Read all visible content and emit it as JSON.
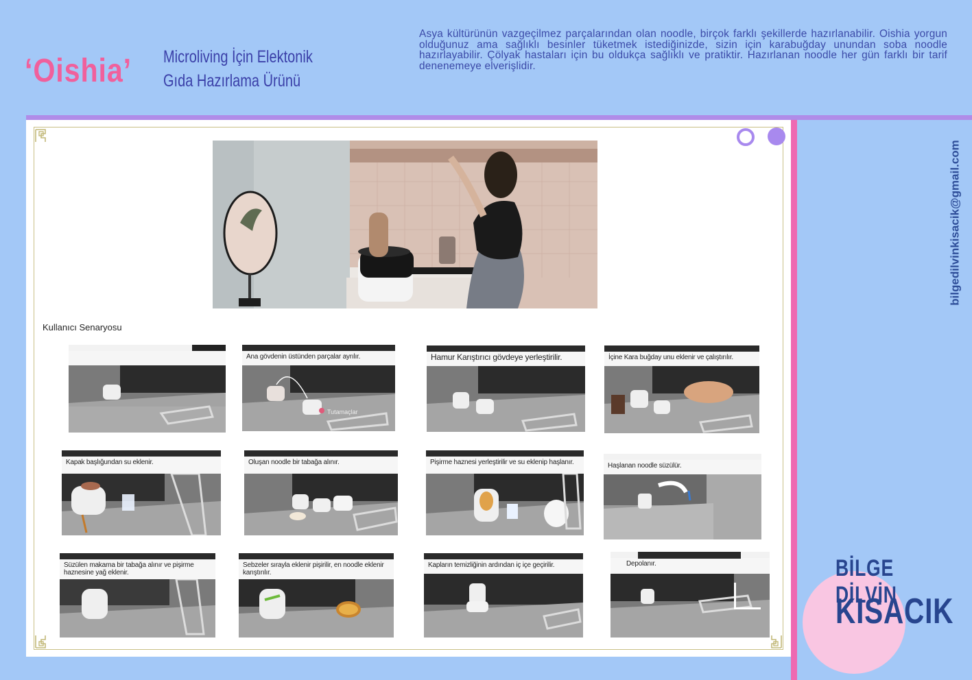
{
  "header": {
    "brand": "‘Oishia’",
    "subtitle_line1": "Microliving İçin Elektonik",
    "subtitle_line2": "Gıda Hazırlama Ürünü",
    "intro": "Asya kültürünün vazgeçilmez parçalarından olan noodle, birçok farklı şekillerde hazırlanabilir. Oishia yorgun olduğunuz ama sağlıklı besinler tüketmek istediğinizde, sizin için karabuğday unundan soba noodle hazırlayabilir. Çölyak hastaları için bu oldukça sağlıklı ve pratiktir. Hazırlanan noodle her gün farklı bir tarif denenemeye elverişlidir."
  },
  "scenario": {
    "title": "Kullanıcı Senaryosu",
    "steps": [
      {
        "caption": "",
        "label": ""
      },
      {
        "caption": "Ana gövdenin üstünden parçalar ayrılır.",
        "label": "Tutamaçlar"
      },
      {
        "caption": "Hamur Karıştırıcı gövdeye yerleştirilir.",
        "label": ""
      },
      {
        "caption": "İçine Kara buğday unu eklenir ve çalıştırılır.",
        "label": ""
      },
      {
        "caption": "Kapak başlığundan su eklenir.",
        "label": ""
      },
      {
        "caption": "Oluşan noodle bir tabağa alınır.",
        "label": ""
      },
      {
        "caption": "Pişirme haznesi  yerleştirilir ve su eklenip haşlanır.",
        "label": ""
      },
      {
        "caption": "Haşlanan noodle süzülür.",
        "label": ""
      },
      {
        "caption": "Süzülen makarna bir tabağa alınır ve pişirme haznesine yağ eklenir.",
        "label": ""
      },
      {
        "caption": "Sebzeler sırayla eklenir pişirilir, en noodle eklenir karıştırılır.",
        "label": ""
      },
      {
        "caption": "Kapların temizliğinin ardından iç içe geçirilir.",
        "label": ""
      },
      {
        "caption": "Depolanır.",
        "label": ""
      }
    ]
  },
  "author": {
    "email": "bilgedilvinkisacik@gmail.com",
    "first_name": "BİLGE DİLVİN",
    "last_name": "KISACIK"
  },
  "colors": {
    "background": "#a3c8f7",
    "brand_pink": "#f0609c",
    "title_blue": "#3a3fa8",
    "purple_bar": "#b08ce8",
    "pink_bar": "#ee69b2",
    "name_blue": "#27458f",
    "pink_circle": "#f9c6e2"
  }
}
